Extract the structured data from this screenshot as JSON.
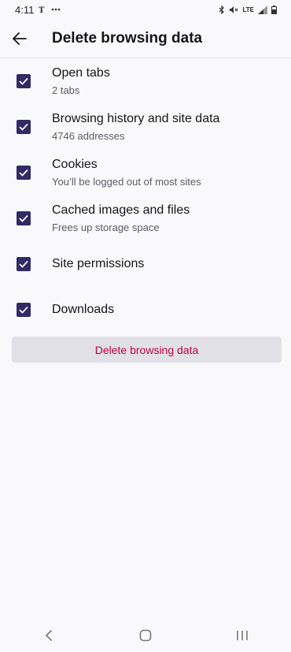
{
  "status_bar": {
    "time": "4:11",
    "network_label": "LTE",
    "icons": [
      "notification-icon",
      "more-dots-icon",
      "bluetooth-icon",
      "mute-icon",
      "signal-icon",
      "battery-icon"
    ]
  },
  "header": {
    "title": "Delete browsing data",
    "back_icon": "arrow-left-icon"
  },
  "options": [
    {
      "label": "Open tabs",
      "sublabel": "2 tabs",
      "checked": true
    },
    {
      "label": "Browsing history and site data",
      "sublabel": "4746 addresses",
      "checked": true
    },
    {
      "label": "Cookies",
      "sublabel": "You’ll be logged out of most sites",
      "checked": true
    },
    {
      "label": "Cached images and files",
      "sublabel": "Frees up storage space",
      "checked": true
    },
    {
      "label": "Site permissions",
      "sublabel": "",
      "checked": true
    },
    {
      "label": "Downloads",
      "sublabel": "",
      "checked": true
    }
  ],
  "delete_button": {
    "label": "Delete browsing data"
  },
  "nav_bar": {
    "buttons": [
      "back-nav-icon",
      "home-nav-icon",
      "recents-nav-icon"
    ]
  },
  "colors": {
    "accent": "#312a65",
    "danger": "#c50042",
    "background": "#f9f9fb",
    "button_bg": "#e0e0e6"
  }
}
